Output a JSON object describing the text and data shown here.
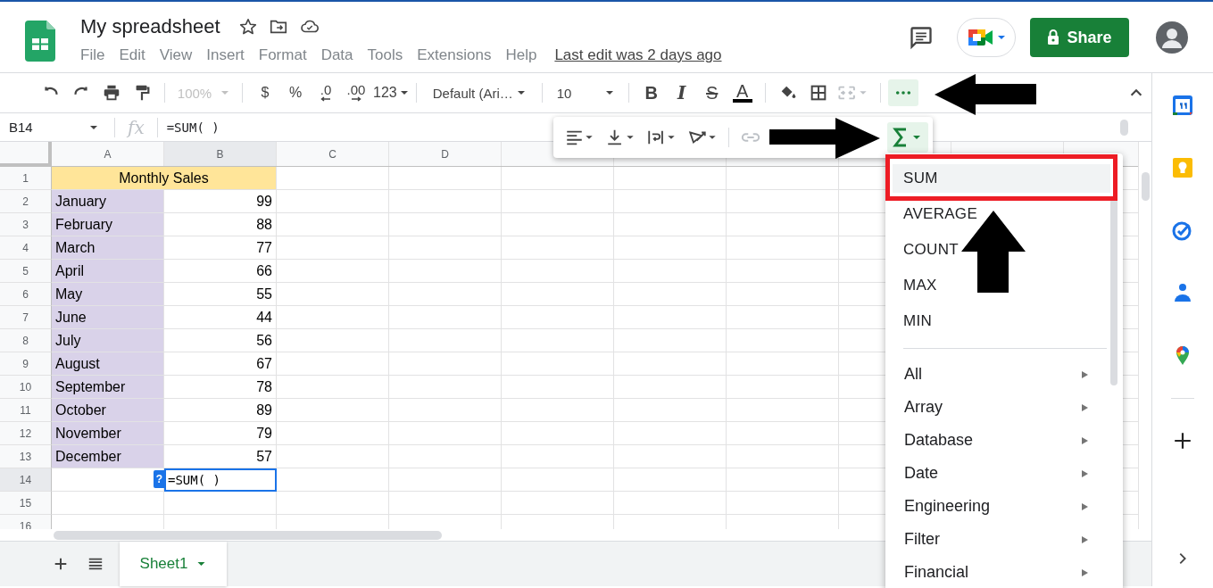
{
  "app": {
    "title": "My spreadsheet",
    "menus": [
      "File",
      "Edit",
      "View",
      "Insert",
      "Format",
      "Data",
      "Tools",
      "Extensions",
      "Help"
    ],
    "last_edit": "Last edit was 2 days ago",
    "share": "Share"
  },
  "toolbar": {
    "zoom": {
      "value": "100%",
      "disabled": true
    },
    "currency": "$",
    "percent": "%",
    "decrease_decimals": ".0",
    "increase_decimals": ".00",
    "number_format": "123",
    "font": "Default (Ari…",
    "font_size": "10",
    "bold": "B",
    "italic": "I",
    "strikethrough": "S",
    "text_color": "A",
    "more_selected": true
  },
  "formula_bar": {
    "cell_ref": "B14",
    "fx": "fx",
    "formula": "=SUM( )"
  },
  "grid": {
    "columns": [
      {
        "label": "A",
        "selected": false
      },
      {
        "label": "B",
        "selected": true
      },
      {
        "label": "C",
        "selected": false
      },
      {
        "label": "D",
        "selected": false
      }
    ],
    "rows": [
      {
        "number": "1",
        "kind": "title",
        "text": "Monthly Sales",
        "selected": false
      },
      {
        "number": "2",
        "kind": "data",
        "month": "January",
        "sales": "99",
        "selected": false
      },
      {
        "number": "3",
        "kind": "data",
        "month": "February",
        "sales": "88",
        "selected": false
      },
      {
        "number": "4",
        "kind": "data",
        "month": "March",
        "sales": "77",
        "selected": false
      },
      {
        "number": "5",
        "kind": "data",
        "month": "April",
        "sales": "66",
        "selected": false
      },
      {
        "number": "6",
        "kind": "data",
        "month": "May",
        "sales": "55",
        "selected": false
      },
      {
        "number": "7",
        "kind": "data",
        "month": "June",
        "sales": "44",
        "selected": false
      },
      {
        "number": "8",
        "kind": "data",
        "month": "July",
        "sales": "56",
        "selected": false
      },
      {
        "number": "9",
        "kind": "data",
        "month": "August",
        "sales": "67",
        "selected": false
      },
      {
        "number": "10",
        "kind": "data",
        "month": "September",
        "sales": "78",
        "selected": false
      },
      {
        "number": "11",
        "kind": "data",
        "month": "October",
        "sales": "89",
        "selected": false
      },
      {
        "number": "12",
        "kind": "data",
        "month": "November",
        "sales": "79",
        "selected": false
      },
      {
        "number": "13",
        "kind": "data",
        "month": "December",
        "sales": "57",
        "selected": false
      },
      {
        "number": "14",
        "kind": "editing",
        "value": "=SUM( )",
        "help": "?",
        "selected": true
      },
      {
        "number": "15",
        "kind": "empty",
        "selected": false
      },
      {
        "number": "16",
        "kind": "empty",
        "selected": false
      }
    ]
  },
  "more_toolbar": {
    "sum_selected": true
  },
  "function_menu": [
    {
      "label": "SUM",
      "kind": "function",
      "selected": true
    },
    {
      "label": "AVERAGE",
      "kind": "function",
      "selected": false
    },
    {
      "label": "COUNT",
      "kind": "function",
      "selected": false
    },
    {
      "label": "MAX",
      "kind": "function",
      "selected": false
    },
    {
      "label": "MIN",
      "kind": "function",
      "selected": false
    },
    {
      "label": "All",
      "kind": "category",
      "selected": false
    },
    {
      "label": "Array",
      "kind": "category",
      "selected": false
    },
    {
      "label": "Database",
      "kind": "category",
      "selected": false
    },
    {
      "label": "Date",
      "kind": "category",
      "selected": false
    },
    {
      "label": "Engineering",
      "kind": "category",
      "selected": false
    },
    {
      "label": "Filter",
      "kind": "category",
      "selected": false
    },
    {
      "label": "Financial",
      "kind": "category",
      "selected": false
    }
  ],
  "sheets": [
    {
      "label": "Sheet1",
      "selected": true
    }
  ]
}
